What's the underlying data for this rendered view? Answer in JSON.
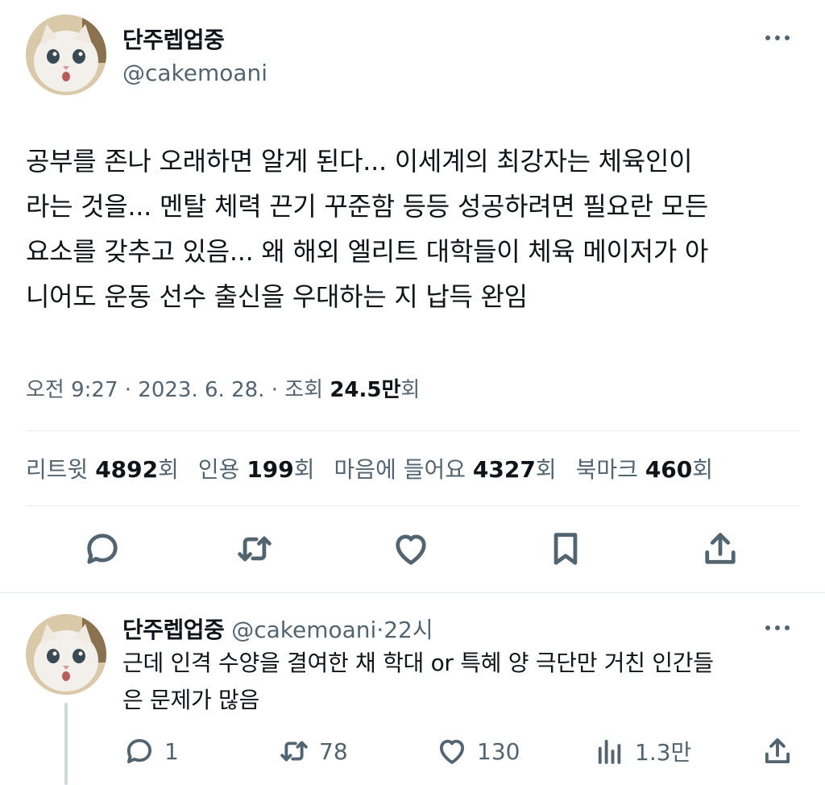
{
  "tweet": {
    "author_name": "단주렙업중",
    "author_handle": "@cakemoani",
    "text_lines": [
      "공부를 존나 오래하면 알게 된다... 이세계의 최강자는 체육인이",
      "라는 것을... 멘탈 체력 끈기 꾸준함 등등 성공하려면 필요란 모든",
      "요소를 갖추고 있음... 왜 해외 엘리트 대학들이 체육 메이저가 아",
      "니어도 운동 선수 출신을 우대하는 지 납득 완임"
    ],
    "time": "오전 9:27",
    "date": "2023. 6. 28.",
    "views_label": "조회",
    "views_count": "24.5만",
    "views_suffix": "회",
    "separator": "·",
    "stats": {
      "retweets_label": "리트윗",
      "retweets_count": "4892",
      "quotes_label": "인용",
      "quotes_count": "199",
      "likes_label": "마음에 들어요",
      "likes_count": "4327",
      "bookmarks_label": "북마크",
      "bookmarks_count": "460",
      "count_suffix": "회"
    }
  },
  "reply": {
    "author_name": "단주렙업중",
    "author_handle": "@cakemoani",
    "separator": "·",
    "time": "22시",
    "text_lines": [
      "근데 인격 수양을 결여한 채 학대 or 특혜 양 극단만 거친 인간들",
      "은 문제가 많음"
    ],
    "reply_count": "1",
    "retweet_count": "78",
    "like_count": "130",
    "view_count": "1.3만"
  },
  "icons": {
    "reply": "speech-bubble-icon",
    "retweet": "retweet-arrows-icon",
    "like": "heart-icon",
    "bookmark": "bookmark-icon",
    "share": "share-upload-icon",
    "views": "bar-chart-icon",
    "more": "more-dots-icon"
  },
  "colors": {
    "text_primary": "#0f1419",
    "text_secondary": "#536471",
    "divider": "#e6e9ec",
    "thread_line": "#cfd9de"
  }
}
